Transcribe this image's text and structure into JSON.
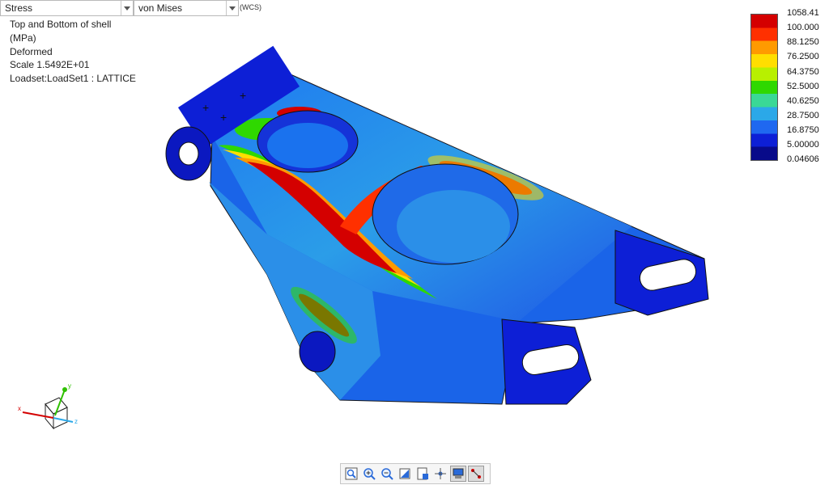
{
  "toolbar_top": {
    "result_type": "Stress",
    "component": "von Mises",
    "coord_system": "(WCS)"
  },
  "info": {
    "line1": "Top and Bottom of shell",
    "line2": "(MPa)",
    "line3": "Deformed",
    "line4": "Scale  1.5492E+01",
    "line5": "Loadset:LoadSet1 :  LATTICE"
  },
  "legend": {
    "labels": [
      "1058.41",
      "100.000",
      "88.1250",
      "76.2500",
      "64.3750",
      "52.5000",
      "40.6250",
      "28.7500",
      "16.8750",
      "5.00000",
      "0.04606"
    ],
    "colors": [
      "#d40000",
      "#ff3000",
      "#ff9a00",
      "#ffde00",
      "#b8f000",
      "#2fd800",
      "#3ad896",
      "#2ba8e8",
      "#1f68f0",
      "#0d1fd6",
      "#080a8a"
    ]
  },
  "triad": {
    "x": "x",
    "y": "y",
    "z": "z"
  },
  "view_toolbar": {
    "buttons": [
      "refit-icon",
      "zoom-in-icon",
      "zoom-out-icon",
      "repaint-icon",
      "saved-views-icon",
      "spin-center-icon",
      "display-style-icon",
      "annotation-icon"
    ]
  }
}
